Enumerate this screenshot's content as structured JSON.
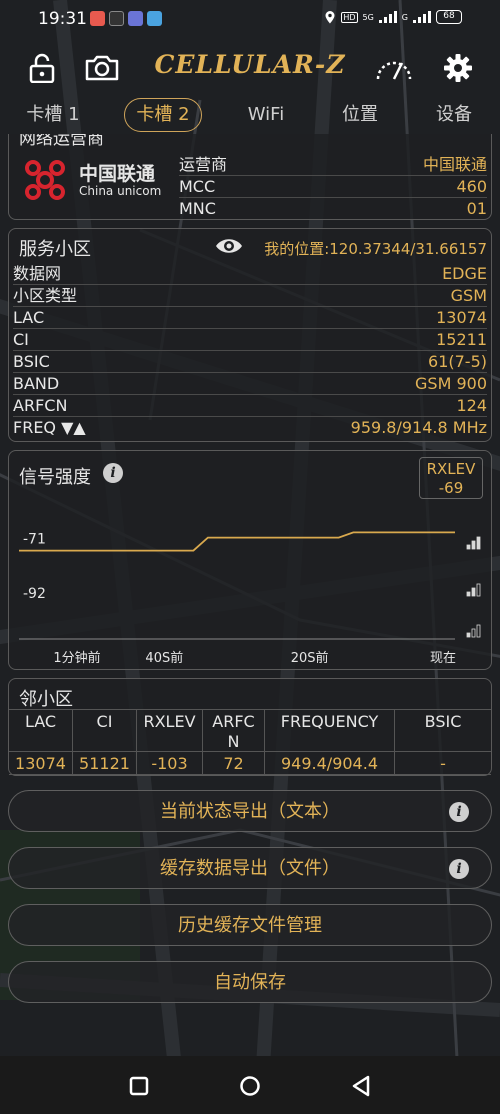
{
  "status_bar": {
    "time": "19:31",
    "network_labels": [
      "HD",
      "5G",
      "G"
    ],
    "battery": "68"
  },
  "app": {
    "title": "CELLULAR-Z"
  },
  "tabs": [
    {
      "label": "卡槽 1",
      "active": false
    },
    {
      "label": "卡槽 2",
      "active": true
    },
    {
      "label": "WiFi",
      "active": false
    },
    {
      "label": "位置",
      "active": false
    },
    {
      "label": "设备",
      "active": false
    }
  ],
  "operator": {
    "header": "网络运营商",
    "logo_cn": "中国联通",
    "logo_en": "China unicom",
    "rows": [
      {
        "key": "运营商",
        "value": "中国联通"
      },
      {
        "key": "MCC",
        "value": "460"
      },
      {
        "key": "MNC",
        "value": "01"
      }
    ]
  },
  "serving_cell": {
    "title": "服务小区",
    "location_text": "我的位置:120.37344/31.66157",
    "rows": [
      {
        "key": "数据网",
        "value": "EDGE"
      },
      {
        "key": "小区类型",
        "value": "GSM"
      },
      {
        "key": "LAC",
        "value": "13074"
      },
      {
        "key": "CI",
        "value": "15211"
      },
      {
        "key": "BSIC",
        "value": "61(7-5)"
      },
      {
        "key": "BAND",
        "value": "GSM 900"
      },
      {
        "key": "ARFCN",
        "value": "124"
      },
      {
        "key": "FREQ ▼▲",
        "value": "959.8/914.8 MHz"
      }
    ]
  },
  "signal": {
    "title": "信号强度",
    "metric_label": "RXLEV",
    "metric_value": "-69",
    "y_labels": [
      "-71",
      "-92"
    ],
    "x_labels": [
      "1分钟前",
      "40S前",
      "20S前",
      "现在"
    ]
  },
  "chart_data": {
    "type": "line",
    "title": "信号强度",
    "xlabel": "",
    "ylabel": "",
    "x": [
      0,
      10,
      20,
      24,
      26,
      40,
      44,
      46,
      60
    ],
    "x_labels": [
      "1分钟前",
      "40S前",
      "20S前",
      "现在"
    ],
    "series": [
      {
        "values": [
          -76,
          -76,
          -76,
          -76,
          -71,
          -71,
          -71,
          -69,
          -69
        ]
      }
    ],
    "y_ticks": [
      -71,
      -92
    ],
    "ylim": [
      -110,
      -60
    ],
    "color": "#d9a94e",
    "grid": false
  },
  "neighbour": {
    "title": "邻小区",
    "headers": [
      "LAC",
      "CI",
      "RXLEV",
      "ARFCN",
      "FREQUENCY",
      "BSIC"
    ],
    "row": [
      "13074",
      "51121",
      "-103",
      "72",
      "949.4/904.4",
      "-"
    ]
  },
  "buttons": {
    "export_status": "当前状态导出（文本）",
    "export_cache": "缓存数据导出（文件）",
    "history_manage": "历史缓存文件管理",
    "auto_save": "自动保存",
    "info_glyph": "i"
  },
  "colors": {
    "accent": "#e2b357",
    "background": "#1d1f22",
    "border": "#5a5a5a"
  }
}
